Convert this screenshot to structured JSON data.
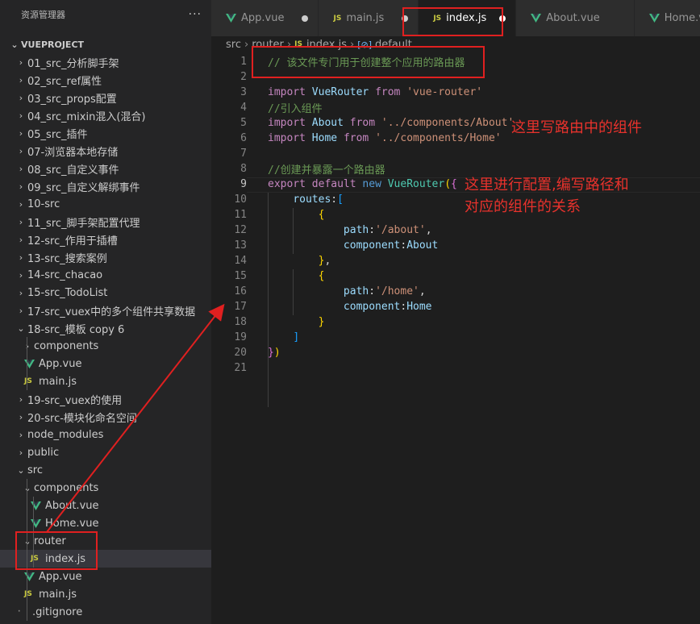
{
  "explorer": {
    "title": "资源管理器",
    "more": "···",
    "root": "VUEPROJECT",
    "items": [
      {
        "label": "01_src_分析脚手架",
        "kind": "folder",
        "open": false,
        "depth": 1
      },
      {
        "label": "02_src_ref属性",
        "kind": "folder",
        "open": false,
        "depth": 1
      },
      {
        "label": "03_src_props配置",
        "kind": "folder",
        "open": false,
        "depth": 1
      },
      {
        "label": "04_src_mixin混入(混合)",
        "kind": "folder",
        "open": false,
        "depth": 1
      },
      {
        "label": "05_src_插件",
        "kind": "folder",
        "open": false,
        "depth": 1
      },
      {
        "label": "07-浏览器本地存储",
        "kind": "folder",
        "open": false,
        "depth": 1
      },
      {
        "label": "08_src_自定义事件",
        "kind": "folder",
        "open": false,
        "depth": 1
      },
      {
        "label": "09_src_自定义解绑事件",
        "kind": "folder",
        "open": false,
        "depth": 1
      },
      {
        "label": "10-src",
        "kind": "folder",
        "open": false,
        "depth": 1
      },
      {
        "label": "11_src_脚手架配置代理",
        "kind": "folder",
        "open": false,
        "depth": 1
      },
      {
        "label": "12-src_作用于插槽",
        "kind": "folder",
        "open": false,
        "depth": 1
      },
      {
        "label": "13-src_搜索案例",
        "kind": "folder",
        "open": false,
        "depth": 1
      },
      {
        "label": "14-src_chacao",
        "kind": "folder",
        "open": false,
        "depth": 1
      },
      {
        "label": "15-src_TodoList",
        "kind": "folder",
        "open": false,
        "depth": 1
      },
      {
        "label": "17-src_vuex中的多个组件共享数据",
        "kind": "folder",
        "open": false,
        "depth": 1
      },
      {
        "label": "18-src_模板 copy 6",
        "kind": "folder",
        "open": true,
        "depth": 1
      },
      {
        "label": "components",
        "kind": "folder",
        "open": false,
        "depth": 2
      },
      {
        "label": "App.vue",
        "kind": "vue",
        "depth": 2
      },
      {
        "label": "main.js",
        "kind": "js",
        "depth": 2
      },
      {
        "label": "19-src_vuex的使用",
        "kind": "folder",
        "open": false,
        "depth": 1
      },
      {
        "label": "20-src-模块化命名空间",
        "kind": "folder",
        "open": false,
        "depth": 1
      },
      {
        "label": "node_modules",
        "kind": "folder",
        "open": false,
        "depth": 1
      },
      {
        "label": "public",
        "kind": "folder",
        "open": false,
        "depth": 1
      },
      {
        "label": "src",
        "kind": "folder",
        "open": true,
        "depth": 1
      },
      {
        "label": "components",
        "kind": "folder",
        "open": true,
        "depth": 2
      },
      {
        "label": "About.vue",
        "kind": "vue",
        "depth": 3
      },
      {
        "label": "Home.vue",
        "kind": "vue",
        "depth": 3
      },
      {
        "label": "router",
        "kind": "folder",
        "open": true,
        "depth": 2
      },
      {
        "label": "index.js",
        "kind": "js",
        "depth": 3,
        "selected": true
      },
      {
        "label": "App.vue",
        "kind": "vue",
        "depth": 2
      },
      {
        "label": "main.js",
        "kind": "js",
        "depth": 2
      },
      {
        "label": ".gitignore",
        "kind": "plain",
        "depth": 1
      }
    ]
  },
  "tabs": [
    {
      "label": "App.vue",
      "kind": "vue",
      "modified": true,
      "active": false
    },
    {
      "label": "main.js",
      "kind": "js",
      "modified": true,
      "active": false
    },
    {
      "label": "index.js",
      "kind": "js",
      "modified": true,
      "active": true
    },
    {
      "label": "About.vue",
      "kind": "vue",
      "modified": false,
      "active": false
    },
    {
      "label": "Home.vue",
      "kind": "vue",
      "modified": false,
      "active": false
    }
  ],
  "breadcrumb": {
    "parts": [
      "src",
      "router",
      "index.js",
      "default"
    ],
    "js_badge": "JS"
  },
  "editor": {
    "current_line": 9,
    "lines": [
      [
        [
          "cm",
          "// 该文件专门用于创建整个应用的路由器"
        ]
      ],
      [],
      [
        [
          "kw2",
          "import "
        ],
        [
          "var",
          "VueRouter "
        ],
        [
          "kw2",
          "from "
        ],
        [
          "str",
          "'vue-router'"
        ]
      ],
      [
        [
          "cm",
          "//引入组件"
        ]
      ],
      [
        [
          "kw2",
          "import "
        ],
        [
          "var",
          "About "
        ],
        [
          "kw2",
          "from "
        ],
        [
          "str",
          "'../components/About'"
        ]
      ],
      [
        [
          "kw2",
          "import "
        ],
        [
          "var",
          "Home "
        ],
        [
          "kw2",
          "from "
        ],
        [
          "str",
          "'../components/Home'"
        ]
      ],
      [],
      [
        [
          "cm",
          "//创建并暴露一个路由器"
        ]
      ],
      [
        [
          "kw2",
          "export "
        ],
        [
          "kw2",
          "default "
        ],
        [
          "kw",
          "new "
        ],
        [
          "cls",
          "VueRouter"
        ],
        [
          "br",
          "("
        ],
        [
          "br2",
          "{"
        ]
      ],
      [
        [
          "pun",
          "    "
        ],
        [
          "var",
          "routes"
        ],
        [
          "pun",
          ":"
        ],
        [
          "br3",
          "["
        ]
      ],
      [
        [
          "pun",
          "        "
        ],
        [
          "br",
          "{"
        ]
      ],
      [
        [
          "pun",
          "            "
        ],
        [
          "var",
          "path"
        ],
        [
          "pun",
          ":"
        ],
        [
          "str",
          "'/about'"
        ],
        [
          "pun",
          ","
        ]
      ],
      [
        [
          "pun",
          "            "
        ],
        [
          "var",
          "component"
        ],
        [
          "pun",
          ":"
        ],
        [
          "var",
          "About"
        ]
      ],
      [
        [
          "pun",
          "        "
        ],
        [
          "br",
          "}"
        ],
        [
          "pun",
          ","
        ]
      ],
      [
        [
          "pun",
          "        "
        ],
        [
          "br",
          "{"
        ]
      ],
      [
        [
          "pun",
          "            "
        ],
        [
          "var",
          "path"
        ],
        [
          "pun",
          ":"
        ],
        [
          "str",
          "'/home'"
        ],
        [
          "pun",
          ","
        ]
      ],
      [
        [
          "pun",
          "            "
        ],
        [
          "var",
          "component"
        ],
        [
          "pun",
          ":"
        ],
        [
          "var",
          "Home"
        ]
      ],
      [
        [
          "pun",
          "        "
        ],
        [
          "br",
          "}"
        ]
      ],
      [
        [
          "pun",
          "    "
        ],
        [
          "br3",
          "]"
        ]
      ],
      [
        [
          "br2",
          "}"
        ],
        [
          "br",
          ")"
        ]
      ],
      []
    ]
  },
  "annotations": {
    "text1": "这里写路由中的组件",
    "text2_line1": "这里进行配置,编写路径和",
    "text2_line2": "对应的组件的关系"
  },
  "colors": {
    "annotation": "#e02020",
    "vue_green": "#42b883",
    "js_yellow": "#cbcb41"
  }
}
